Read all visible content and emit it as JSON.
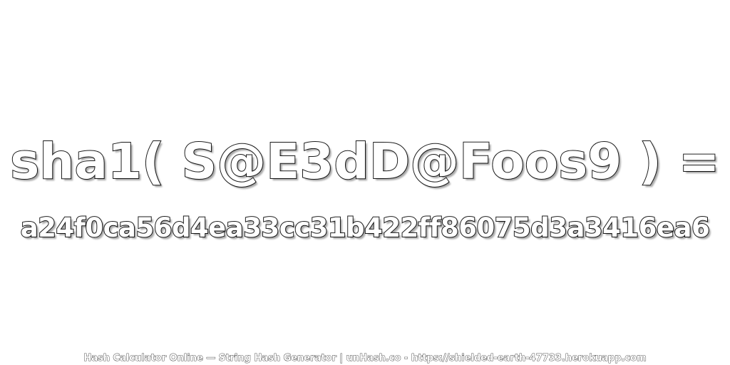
{
  "expression": {
    "text": "sha1( S@E3dD@Foos9 ) ="
  },
  "hash": {
    "text": "a24f0ca56d4ea33cc31b422ff86075d3a3416ea6"
  },
  "footer": {
    "text": "Hash Calculator Online — String Hash Generator | unHash.co - https://shielded-earth-47733.herokuapp.com"
  },
  "colors": {
    "background": "#ffffff",
    "text_fill": "#ffffff",
    "text_outline": "#1a1a1a"
  }
}
